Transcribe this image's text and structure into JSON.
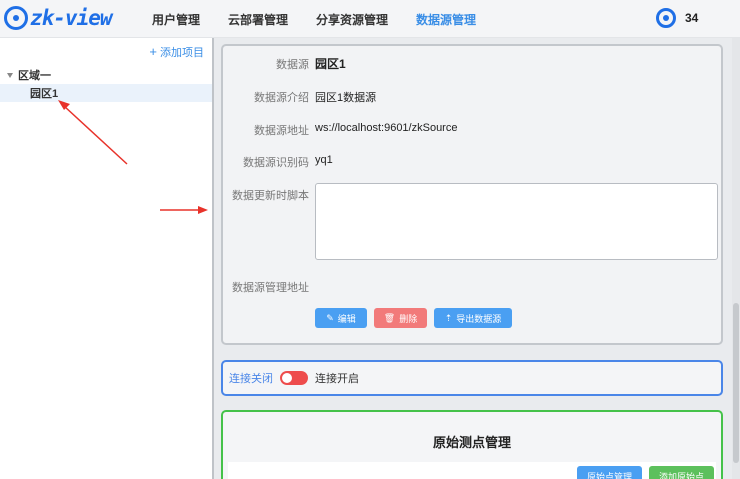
{
  "header": {
    "logo_text": "zk-view",
    "nav": [
      {
        "label": "用户管理",
        "active": false
      },
      {
        "label": "云部署管理",
        "active": false
      },
      {
        "label": "分享资源管理",
        "active": false
      },
      {
        "label": "数据源管理",
        "active": true
      }
    ],
    "user_count": "34"
  },
  "sidebar": {
    "add_label": "添加项目",
    "tree": {
      "group": "区域一",
      "item": "园区1"
    }
  },
  "detail": {
    "name_label": "数据源",
    "name_value": "园区1",
    "intro_label": "数据源介绍",
    "intro_value": "园区1数据源",
    "address_label": "数据源地址",
    "address_value": "ws://localhost:9601/zkSource",
    "code_label": "数据源识别码",
    "code_value": "yq1",
    "script_label": "数据更新时脚本",
    "script_value": "",
    "mgmt_label": "数据源管理地址",
    "mgmt_value": "",
    "buttons": {
      "edit": "编辑",
      "delete": "删除",
      "export": "导出数据源"
    }
  },
  "connection": {
    "off_label": "连接关闭",
    "on_label": "连接开启",
    "state": "off"
  },
  "raw_points": {
    "title": "原始测点管理",
    "manage_button": "原始点管理",
    "add_button": "添加原始点"
  },
  "colors": {
    "accent": "#3a8ee6",
    "danger": "#ee4c4c",
    "success": "#45c24a",
    "annotation": "#e8322a"
  }
}
